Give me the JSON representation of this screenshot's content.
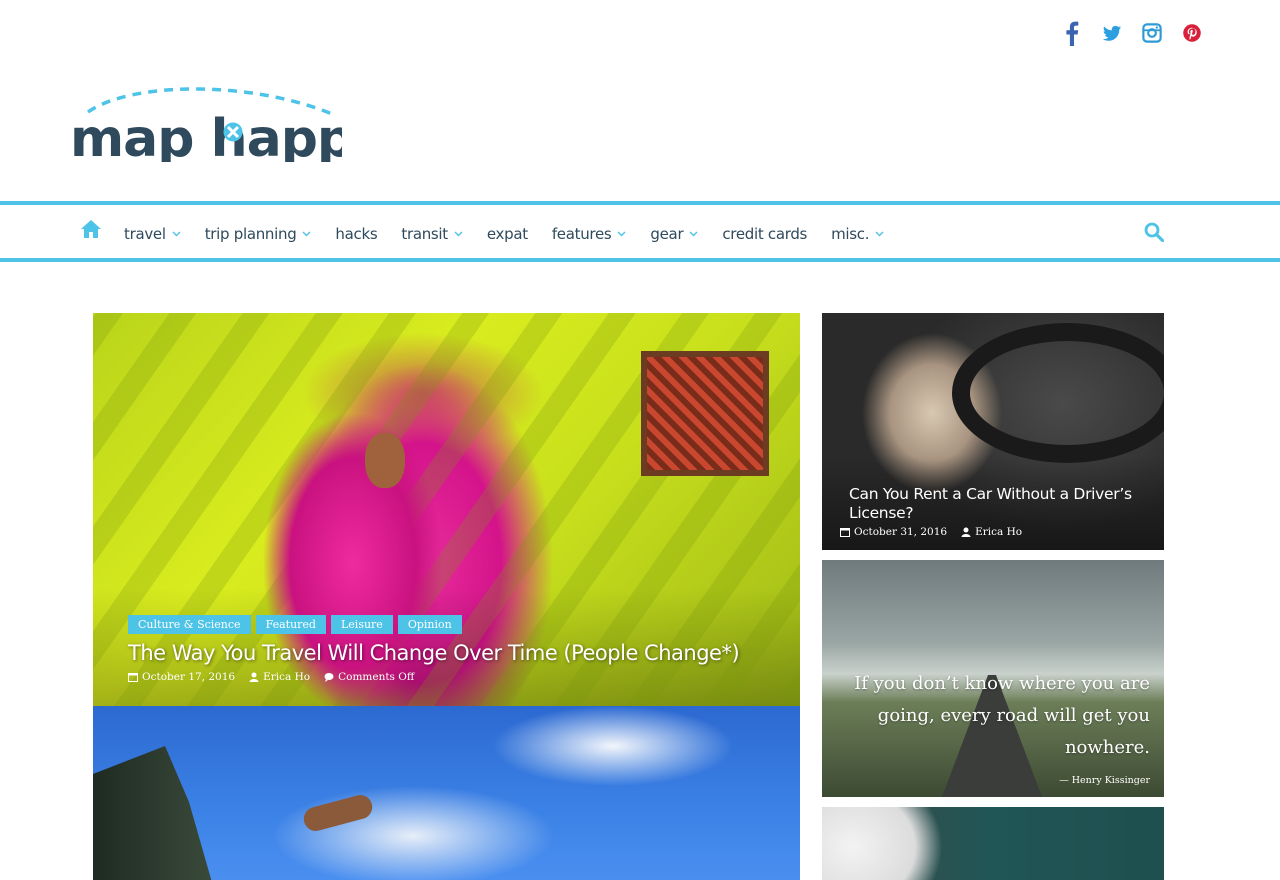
{
  "brand": {
    "logo_text": "map happy",
    "accent": "#4ec3e8",
    "text_color": "#2f4a5c"
  },
  "social": [
    {
      "name": "facebook-icon"
    },
    {
      "name": "twitter-icon"
    },
    {
      "name": "instagram-icon"
    },
    {
      "name": "pinterest-icon"
    }
  ],
  "nav": {
    "items": [
      {
        "label": "travel",
        "has_dropdown": true
      },
      {
        "label": "trip planning",
        "has_dropdown": true
      },
      {
        "label": "hacks",
        "has_dropdown": false
      },
      {
        "label": "transit",
        "has_dropdown": true
      },
      {
        "label": "expat",
        "has_dropdown": false
      },
      {
        "label": "features",
        "has_dropdown": true
      },
      {
        "label": "gear",
        "has_dropdown": true
      },
      {
        "label": "credit cards",
        "has_dropdown": false
      },
      {
        "label": "misc.",
        "has_dropdown": true
      }
    ]
  },
  "featured": {
    "categories": [
      "Culture & Science",
      "Featured",
      "Leisure",
      "Opinion"
    ],
    "title": "The Way You Travel Will Change Over Time (People Change*)",
    "date": "October 17, 2016",
    "author": "Erica Ho",
    "comments": "Comments Off"
  },
  "side_posts": [
    {
      "title": "Can You Rent a Car Without a Driver’s License?",
      "date": "October 31, 2016",
      "author": "Erica Ho"
    }
  ],
  "quote": {
    "text": "If you don’t know where you are going, every road will get you nowhere.",
    "author": "— Henry Kissinger"
  }
}
